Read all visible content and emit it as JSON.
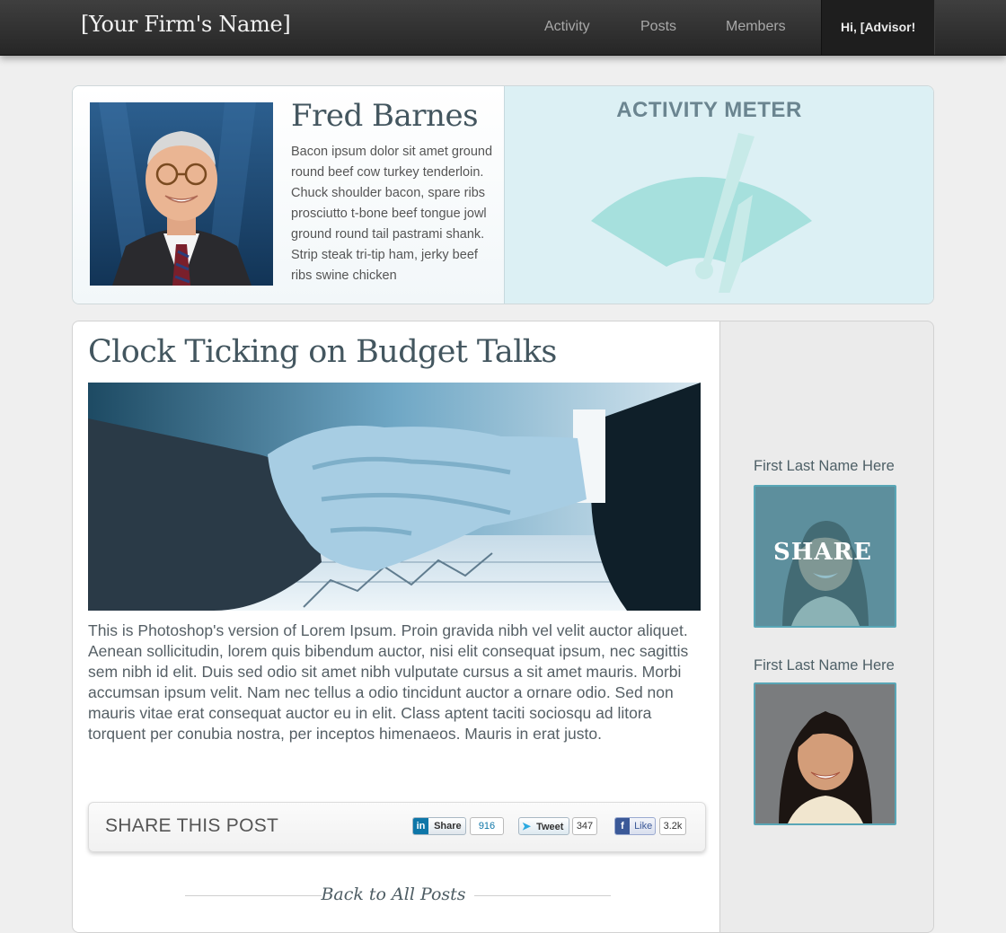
{
  "header": {
    "brand": "[Your Firm's Name]",
    "nav": [
      "Activity",
      "Posts",
      "Members"
    ],
    "greeting": "Hi, [Advisor!"
  },
  "profile": {
    "name": "Fred Barnes",
    "bio": "Bacon ipsum dolor sit amet ground round beef cow turkey tenderloin. Chuck shoulder bacon, spare ribs prosciutto t-bone beef tongue jowl ground round tail pastrami shank. Strip steak tri-tip ham, jerky beef ribs swine chicken",
    "meter_title": "ACTIVITY METER",
    "meter_colors": {
      "panel": "#dcf0f4",
      "gauge": "#a6e0dd",
      "needle": "#c7eae8"
    }
  },
  "article": {
    "title": "Clock Ticking on Budget Talks",
    "body": "This is Photoshop's version  of Lorem Ipsum. Proin gravida nibh vel velit auctor aliquet. Aenean sollicitudin, lorem quis bibendum auctor, nisi elit consequat ipsum, nec sagittis sem nibh id elit. Duis sed odio sit amet nibh vulputate cursus a sit amet mauris. Morbi accumsan ipsum velit. Nam nec tellus a odio tincidunt auctor a ornare odio. Sed non  mauris vitae erat consequat auctor eu in elit. Class aptent taciti sociosqu ad litora torquent per conubia nostra, per inceptos himenaeos. Mauris in erat justo.",
    "share_title": "SHARE THIS POST",
    "share_buttons": [
      {
        "icon": "linkedin-icon",
        "label": "Share",
        "count": "916"
      },
      {
        "icon": "twitter-icon",
        "label": "Tweet",
        "count": "347"
      },
      {
        "icon": "facebook-icon",
        "label": "Like",
        "count": "3.2k"
      }
    ],
    "back_link": "Back to All Posts"
  },
  "sidebar": {
    "members": [
      {
        "name": "First Last Name Here",
        "overlay": "SHARE"
      },
      {
        "name": "First Last Name Here"
      }
    ]
  }
}
